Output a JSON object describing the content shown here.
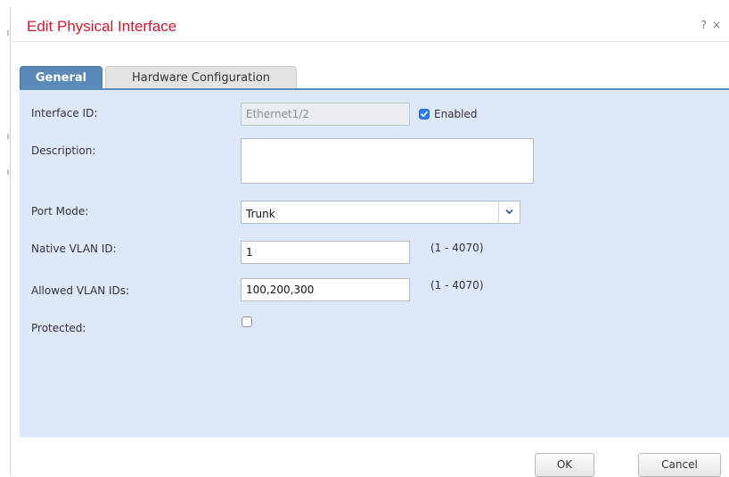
{
  "dialog": {
    "title": "Edit Physical Interface",
    "help_label": "?",
    "close_label": "×"
  },
  "tabs": [
    {
      "label": "General",
      "active": true
    },
    {
      "label": "Hardware Configuration",
      "active": false
    }
  ],
  "form": {
    "interface_id": {
      "label": "Interface ID:",
      "value": "Ethernet1/2"
    },
    "enabled": {
      "label": "Enabled",
      "checked": true
    },
    "description": {
      "label": "Description:",
      "value": ""
    },
    "port_mode": {
      "label": "Port Mode:",
      "value": "Trunk"
    },
    "native_vlan": {
      "label": "Native VLAN ID:",
      "value": "1",
      "range": "(1 - 4070)"
    },
    "allowed_vlans": {
      "label": "Allowed VLAN IDs:",
      "value": "100,200,300",
      "range": "(1 - 4070)"
    },
    "protected": {
      "label": "Protected:",
      "checked": false
    }
  },
  "buttons": {
    "ok": "OK",
    "cancel": "Cancel"
  },
  "colors": {
    "title": "#cc1a30",
    "tab_active": "#5a8ab8",
    "panel_bg": "#dde9fa",
    "checkbox_on": "#2f7be8"
  }
}
